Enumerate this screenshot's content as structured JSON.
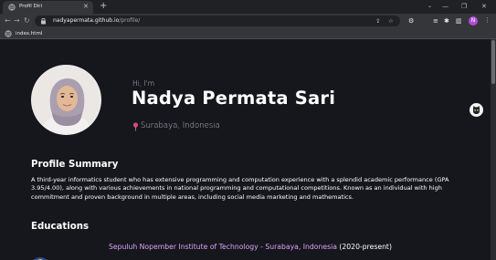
{
  "browser": {
    "tab_title": "Profil Diri",
    "tab_close": "✕",
    "new_tab": "+",
    "url_host": "nadyapermata.github.io",
    "url_path": "/profile/",
    "profile_initial": "N",
    "bookmark_label": "index.html"
  },
  "profile": {
    "greeting": "Hi, I'm",
    "name": "Nadya Permata Sari",
    "location": "Surabaya, Indonesia"
  },
  "summary": {
    "heading": "Profile Summary",
    "text": "A third-year informatics student who has extensive programming and computation experience with a splendid academic performance (GPA 3.95/4.00), along with various achievements in national programming and computational competitions. Known as an individual with high commitment and proven background in multiple areas, including social media marketing and mathematics."
  },
  "education": {
    "heading": "Educations",
    "school": "Sepuluh Nopember Institute of Technology - Surabaya, Indonesia",
    "years": "(2020-present)"
  },
  "colors": {
    "page_bg": "#16161d",
    "accent_school": "#d9a5f3",
    "pin": "#e0457b"
  },
  "icons": {
    "lock": "lock-icon",
    "pin": "map-pin-icon",
    "badge": "dark-mode-toggle-icon"
  }
}
